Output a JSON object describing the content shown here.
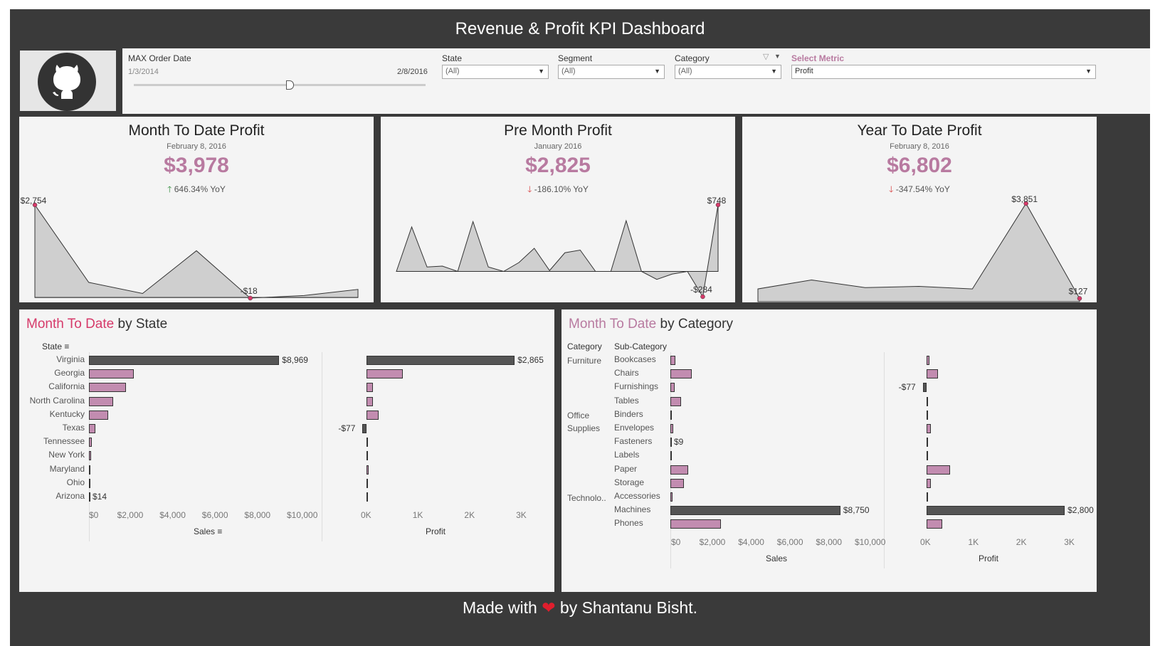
{
  "title": "Revenue & Profit KPI Dashboard",
  "filters": {
    "date": {
      "label": "MAX Order Date",
      "min": "1/3/2014",
      "max": "2/8/2016"
    },
    "state": {
      "label": "State",
      "value": "(All)"
    },
    "segment": {
      "label": "Segment",
      "value": "(All)"
    },
    "category": {
      "label": "Category",
      "value": "(All)"
    },
    "metric": {
      "label": "Select Metric",
      "value": "Profit"
    }
  },
  "kpis": [
    {
      "title": "Month To Date Profit",
      "date": "February 8, 2016",
      "value": "$3,978",
      "yoy": "646.34% YoY",
      "direction": "up"
    },
    {
      "title": "Pre Month Profit",
      "date": "January 2016",
      "value": "$2,825",
      "yoy": "-186.10% YoY",
      "direction": "down"
    },
    {
      "title": "Year To Date Profit",
      "date": "February 8, 2016",
      "value": "$6,802",
      "yoy": "-347.54% YoY",
      "direction": "down"
    }
  ],
  "state_panel": {
    "title_accent": "Month To Date",
    "title_rest": " by State",
    "dim_header": "State",
    "sales_axis": "Sales",
    "profit_axis": "Profit",
    "sales_ticks": [
      "$0",
      "$2,000",
      "$4,000",
      "$6,000",
      "$8,000",
      "$10,000"
    ],
    "profit_ticks": [
      "0K",
      "1K",
      "2K",
      "3K"
    ]
  },
  "category_panel": {
    "title_accent": "Month To Date",
    "title_rest": " by Category",
    "cat_header": "Category",
    "sub_header": "Sub-Category",
    "sales_axis": "Sales",
    "profit_axis": "Profit",
    "sales_ticks": [
      "$0",
      "$2,000",
      "$4,000",
      "$6,000",
      "$8,000",
      "$10,000"
    ],
    "profit_ticks": [
      "0K",
      "1K",
      "2K",
      "3K"
    ],
    "categories": [
      {
        "name": "Furniture",
        "lines": [
          "Furniture"
        ]
      },
      {
        "name": "Office Supplies",
        "lines": [
          "Office",
          "Supplies"
        ]
      },
      {
        "name": "Technolo..",
        "lines": [
          "Technolo.."
        ]
      }
    ]
  },
  "footer": {
    "before": "Made with",
    "heart": "❤",
    "after": "by Shantanu Bisht."
  },
  "colors": {
    "accent": "#b87aa0",
    "state_accent": "#d63a6a",
    "bar": "#c28cb0",
    "bar_highlight": "#555555",
    "frame": "#3a3a3a"
  },
  "icons": {
    "logo": "github-octocat-icon"
  },
  "chart_data": [
    {
      "type": "area",
      "title": "Month To Date Profit",
      "series": [
        {
          "values": [
            2754,
            450,
            120,
            1390,
            -18,
            60,
            240
          ]
        }
      ],
      "annotations": [
        {
          "index": 0,
          "label": "$2,754"
        },
        {
          "index": 4,
          "label": "-$18"
        }
      ]
    },
    {
      "type": "area",
      "title": "Pre Month Profit",
      "series": [
        {
          "values": [
            0,
            500,
            50,
            60,
            0,
            560,
            50,
            0,
            100,
            260,
            10,
            210,
            240,
            0,
            0,
            570,
            0,
            -90,
            -30,
            0,
            -284,
            748
          ]
        }
      ],
      "annotations": [
        {
          "index": 21,
          "label": "$748"
        },
        {
          "index": 20,
          "label": "-$284"
        }
      ]
    },
    {
      "type": "area",
      "title": "Year To Date Profit",
      "series": [
        {
          "values": [
            500,
            850,
            550,
            600,
            500,
            3851,
            127
          ]
        }
      ],
      "annotations": [
        {
          "index": 5,
          "label": "$3,851"
        },
        {
          "index": 6,
          "label": "$127"
        }
      ]
    },
    {
      "type": "bar",
      "title": "Month To Date by State",
      "xlabel": "Sales",
      "categories": [
        "Virginia",
        "Georgia",
        "California",
        "North Carolina",
        "Kentucky",
        "Texas",
        "Tennessee",
        "New York",
        "Maryland",
        "Ohio",
        "Arizona"
      ],
      "values": [
        8969,
        2100,
        1750,
        1150,
        900,
        300,
        120,
        100,
        80,
        20,
        14
      ],
      "labels": {
        "0": "$8,969",
        "10": "$14"
      },
      "xlim": [
        0,
        10000
      ]
    },
    {
      "type": "bar",
      "title": "Month To Date by State",
      "xlabel": "Profit",
      "categories": [
        "Virginia",
        "Georgia",
        "California",
        "North Carolina",
        "Kentucky",
        "Texas",
        "Tennessee",
        "New York",
        "Maryland",
        "Ohio",
        "Arizona"
      ],
      "values": [
        2865,
        700,
        130,
        130,
        240,
        -77,
        10,
        15,
        40,
        5,
        8
      ],
      "labels": {
        "0": "$2,865",
        "5": "-$77"
      },
      "xlim": [
        0,
        3000
      ]
    },
    {
      "type": "bar",
      "title": "Month To Date by Category",
      "xlabel": "Sales",
      "categories": [
        "Bookcases",
        "Chairs",
        "Furnishings",
        "Tables",
        "Binders",
        "Envelopes",
        "Fasteners",
        "Labels",
        "Paper",
        "Storage",
        "Accessories",
        "Machines",
        "Phones"
      ],
      "groups": [
        "Furniture",
        "Furniture",
        "Furniture",
        "Furniture",
        "Office Supplies",
        "Office Supplies",
        "Office Supplies",
        "Office Supplies",
        "Office Supplies",
        "Office Supplies",
        "Technolo..",
        "Technolo..",
        "Technolo.."
      ],
      "values": [
        250,
        1100,
        230,
        550,
        40,
        150,
        9,
        20,
        930,
        700,
        120,
        8750,
        2600
      ],
      "labels": {
        "6": "$9",
        "11": "$8,750"
      },
      "xlim": [
        0,
        10000
      ]
    },
    {
      "type": "bar",
      "title": "Month To Date by Category",
      "xlabel": "Profit",
      "categories": [
        "Bookcases",
        "Chairs",
        "Furnishings",
        "Tables",
        "Binders",
        "Envelopes",
        "Fasteners",
        "Labels",
        "Paper",
        "Storage",
        "Accessories",
        "Machines",
        "Phones"
      ],
      "values": [
        60,
        230,
        -77,
        15,
        10,
        80,
        5,
        10,
        470,
        80,
        20,
        2800,
        320
      ],
      "labels": {
        "2": "-$77",
        "11": "$2,800"
      },
      "xlim": [
        0,
        3000
      ]
    }
  ]
}
